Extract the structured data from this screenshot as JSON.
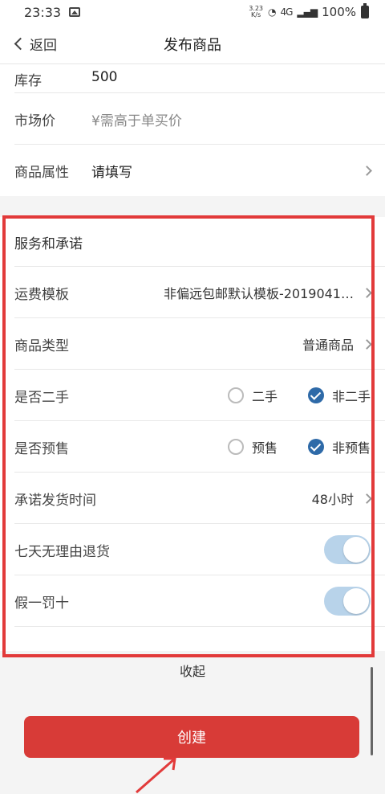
{
  "status": {
    "time": "23:33",
    "speed_top": "3.23",
    "speed_bottom": "K/s",
    "net": "4G",
    "battery": "100%"
  },
  "nav": {
    "back": "返回",
    "title": "发布商品"
  },
  "top_rows": [
    {
      "label": "库存",
      "value": "500"
    },
    {
      "label": "市场价",
      "value": "¥需高于单买价"
    },
    {
      "label": "商品属性",
      "value": "请填写"
    }
  ],
  "service": {
    "title": "服务和承诺",
    "shipping": {
      "label": "运费模板",
      "value": "非偏远包邮默认模板-2019041…"
    },
    "type": {
      "label": "商品类型",
      "value": "普通商品"
    },
    "second_hand": {
      "label": "是否二手",
      "opt1": "二手",
      "opt2": "非二手",
      "selected": "非二手"
    },
    "presale": {
      "label": "是否预售",
      "opt1": "预售",
      "opt2": "非预售",
      "selected": "非预售"
    },
    "ship_time": {
      "label": "承诺发货时间",
      "value": "48小时"
    },
    "seven_day": {
      "label": "七天无理由退货",
      "on": true
    },
    "fake_penalty": {
      "label": "假一罚十",
      "on": true
    }
  },
  "collapse": "收起",
  "create": "创建",
  "colors": {
    "accent": "#d83b37",
    "highlight_frame": "#e23a3a",
    "radio_checked": "#2e6aa8",
    "toggle_on": "#b8d3ea"
  }
}
